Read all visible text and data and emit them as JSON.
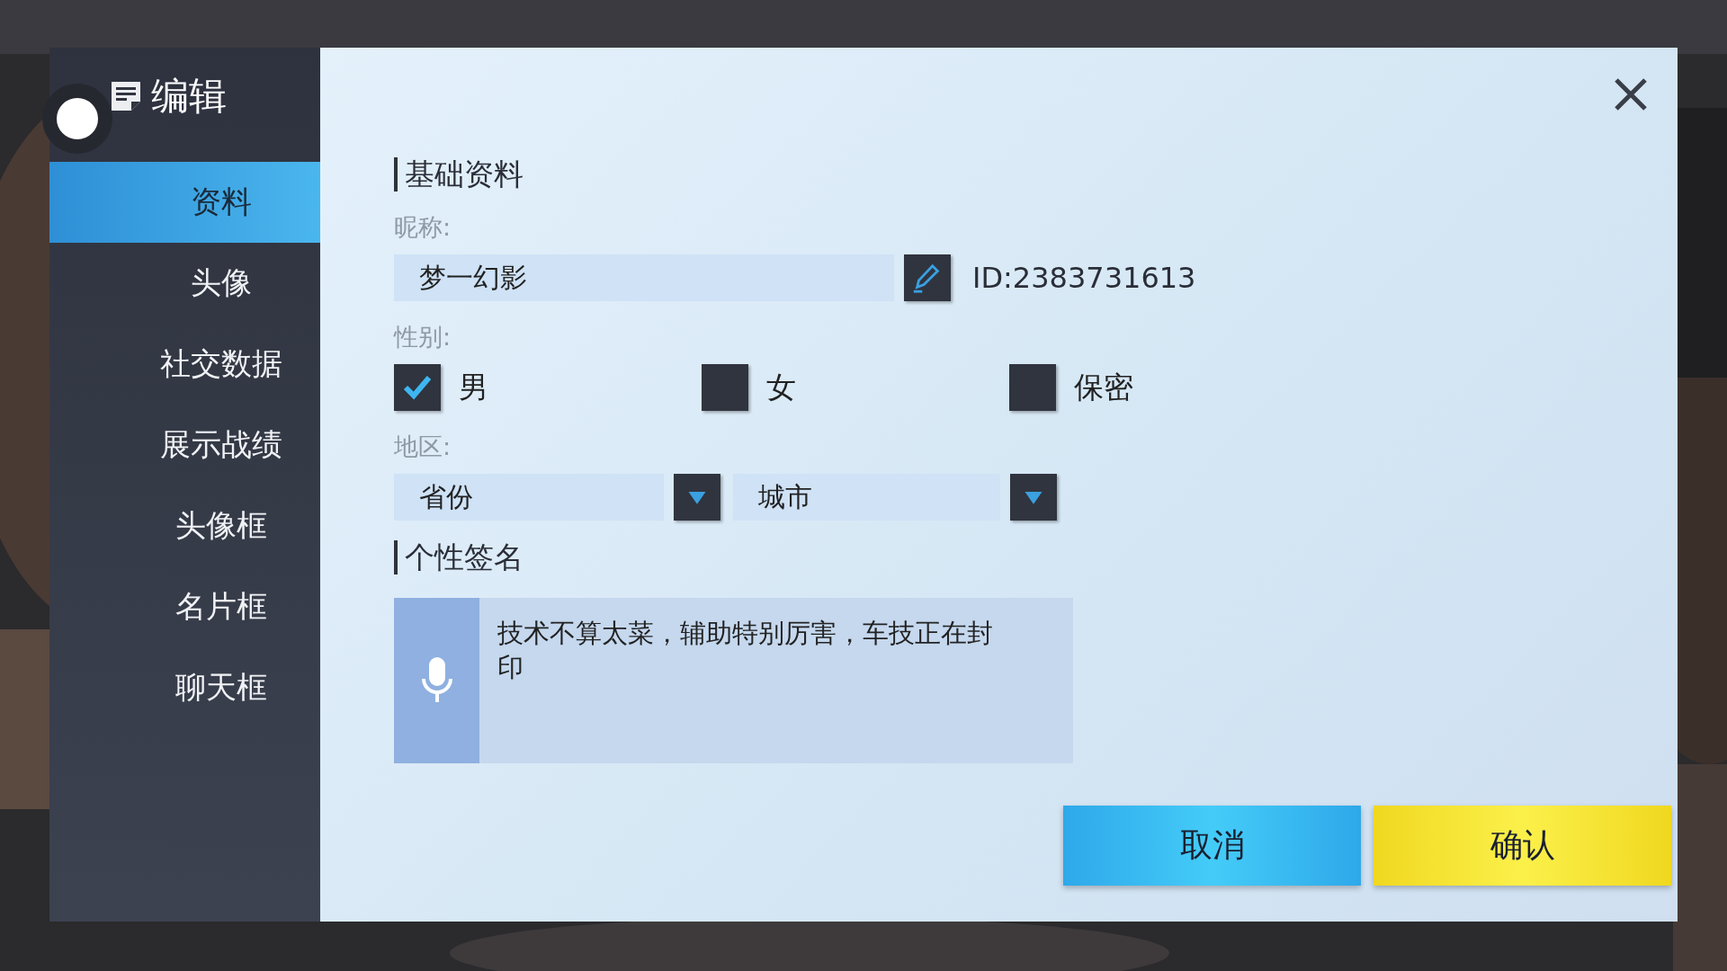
{
  "header": {
    "title": "编辑"
  },
  "sidebar": {
    "items": [
      {
        "label": "资料",
        "selected": true
      },
      {
        "label": "头像",
        "selected": false
      },
      {
        "label": "社交数据",
        "selected": false
      },
      {
        "label": "展示战绩",
        "selected": false
      },
      {
        "label": "头像框",
        "selected": false
      },
      {
        "label": "名片框",
        "selected": false
      },
      {
        "label": "聊天框",
        "selected": false
      }
    ]
  },
  "basic_section": {
    "title": "基础资料"
  },
  "nickname": {
    "label": "昵称:",
    "value": "梦一幻影",
    "id_text": "ID:2383731613"
  },
  "gender": {
    "label": "性别:",
    "options": [
      {
        "label": "男",
        "checked": true
      },
      {
        "label": "女",
        "checked": false
      },
      {
        "label": "保密",
        "checked": false
      }
    ]
  },
  "region": {
    "label": "地区:",
    "dropdowns": [
      {
        "value": "省份"
      },
      {
        "value": "城市"
      }
    ]
  },
  "signature": {
    "title": "个性签名",
    "value": "技术不算太菜，辅助特别厉害，车技正在封印"
  },
  "buttons": [
    {
      "label": "取消",
      "kind": "cancel"
    },
    {
      "label": "确认",
      "kind": "confirm"
    }
  ]
}
